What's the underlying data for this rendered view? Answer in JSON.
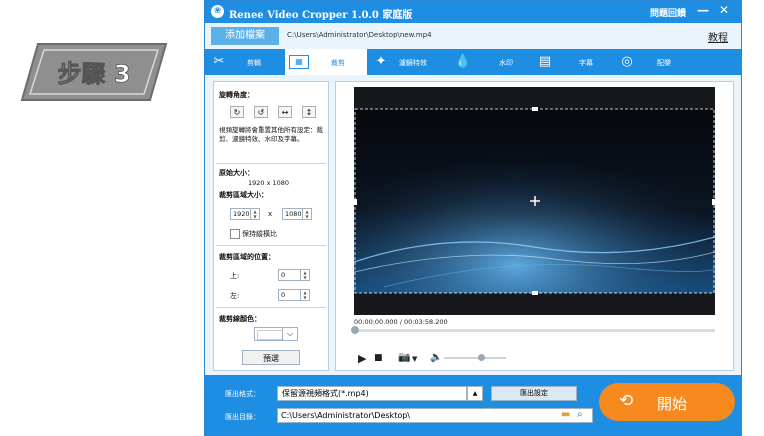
{
  "step_badge": {
    "text": "步驟 3"
  },
  "window": {
    "title": "Renee Video Cropper 1.0.0 家庭版",
    "help_label": "問題回饋",
    "minimize": "—",
    "close": "✕"
  },
  "filebar": {
    "add_label": "添加檔案",
    "path": "C:\\Users\\Administrator\\Desktop\\new.mp4",
    "tutorial": "教程"
  },
  "tabs": [
    {
      "label": "剪輯",
      "icon": "scissors-icon"
    },
    {
      "label": "裁剪",
      "icon": "crop-icon",
      "active": true
    },
    {
      "label": "濾鏡特效",
      "icon": "effects-icon"
    },
    {
      "label": "水印",
      "icon": "watermark-icon"
    },
    {
      "label": "字幕",
      "icon": "subtitle-icon"
    },
    {
      "label": "配樂",
      "icon": "music-icon"
    }
  ],
  "crop_panel": {
    "rotation_title": "旋轉角度：",
    "rotation_note": "視頻旋轉將會重置其他所有設定：裁剪、濾鏡特效、水印及字幕。",
    "original_size_title": "原始大小：",
    "original_size": "1920 x 1080",
    "crop_size_title": "裁剪區域大小：",
    "crop_width": "1920",
    "crop_height": "1080",
    "times": "x",
    "keep_ratio_label": "保持縱橫比",
    "keep_ratio_checked": false,
    "position_title": "裁剪區域的位置：",
    "top_label": "上:",
    "top_value": "0",
    "left_label": "左:",
    "left_value": "0",
    "line_color_title": "裁剪線顏色：",
    "line_color": "#ffffff",
    "preview_label": "預選"
  },
  "player": {
    "timecode": "00:00:00.000 / 00:03:58.200",
    "progress": 0,
    "volume": 0.6
  },
  "output": {
    "format_label": "匯出格式：",
    "format_value": "保留源視頻格式(*.mp4)",
    "settings_label": "匯出設定",
    "dir_label": "匯出目錄：",
    "dir_value": "C:\\Users\\Administrator\\Desktop\\",
    "start_label": "開始"
  },
  "colors": {
    "accent": "#1e8ee3",
    "start": "#f68a1e",
    "badge": "#9a9a9a"
  }
}
